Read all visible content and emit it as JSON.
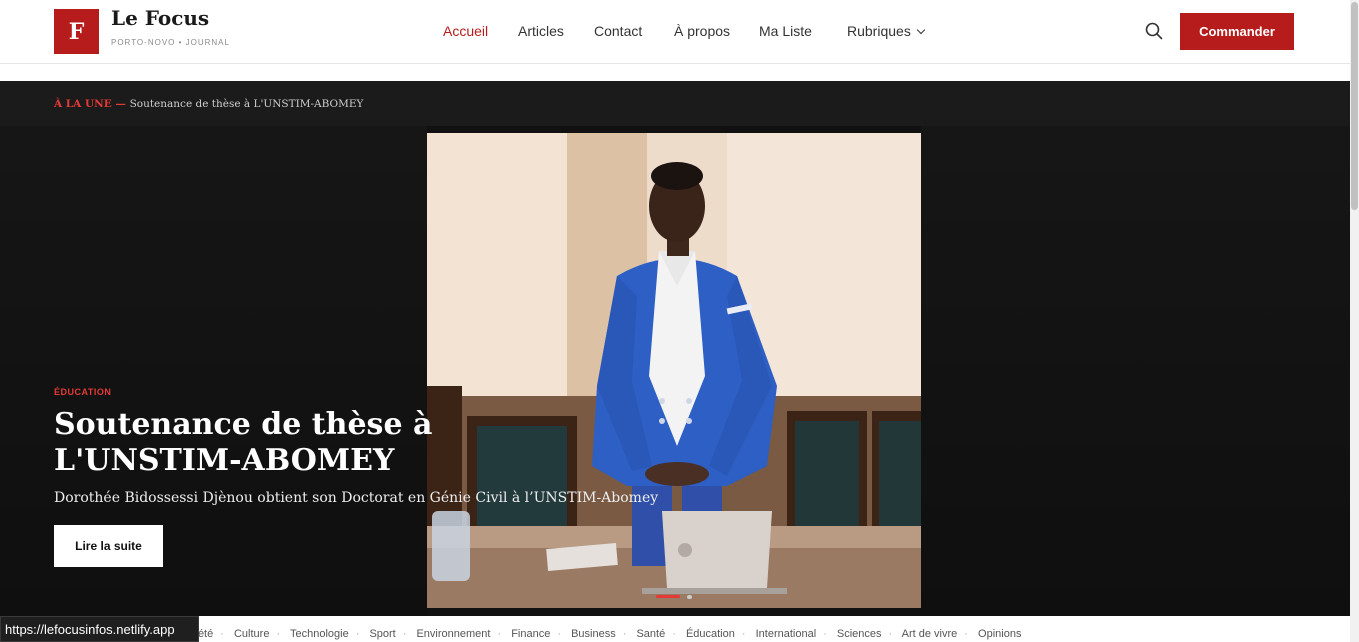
{
  "brand": {
    "logo_letter": "F",
    "name": "Le Focus",
    "tagline": "PORTO-NOVO • JOURNAL",
    "accent": "#b71c1c"
  },
  "nav": {
    "items": [
      {
        "label": "Accueil",
        "active": true
      },
      {
        "label": "Articles"
      },
      {
        "label": "Contact"
      },
      {
        "label": "À propos"
      },
      {
        "label": "Ma Liste"
      },
      {
        "label": "Rubriques"
      }
    ],
    "search_icon": "search-icon",
    "cta_label": "Commander"
  },
  "ticker": {
    "tag": "À LA UNE",
    "separator": " — ",
    "text": "Soutenance de thèse à L'UNSTIM-ABOMEY"
  },
  "hero": {
    "category": "ÉDUCATION",
    "title": "Soutenance de thèse à L'UNSTIM-ABOMEY",
    "description": "Dorothée Bidossessi Djènou obtient son Doctorat en Génie Civil à l’UNSTIM-Abomey",
    "button_label": "Lire la suite",
    "slide_count": 2,
    "active_slide": 1
  },
  "categories": [
    "ciété",
    "Culture",
    "Technologie",
    "Sport",
    "Environnement",
    "Finance",
    "Business",
    "Santé",
    "Éducation",
    "International",
    "Sciences",
    "Art de vivre",
    "Opinions"
  ],
  "status_bar": {
    "url": "https://lefocusinfos.netlify.app"
  }
}
